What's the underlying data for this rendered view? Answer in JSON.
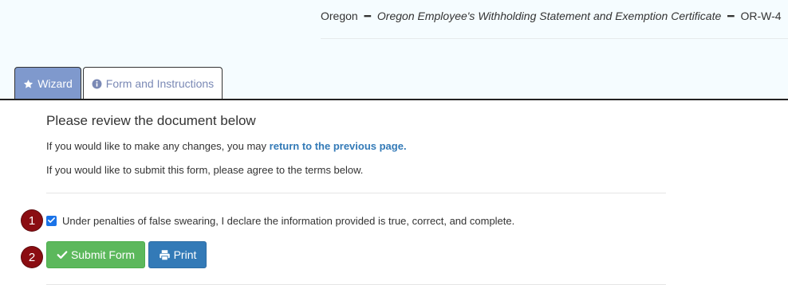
{
  "header": {
    "state": "Oregon",
    "separator": "━",
    "document_name": "Oregon Employee's Withholding Statement and Exemption Certificate",
    "form_code": "OR-W-4"
  },
  "tabs": [
    {
      "label": "Wizard",
      "icon": "star-icon",
      "active": true
    },
    {
      "label": "Form and Instructions",
      "icon": "info-circle-icon",
      "active": false
    }
  ],
  "review": {
    "heading": "Please review the document below",
    "changes_prefix": "If you would like to make any changes, you may ",
    "changes_link": "return to the previous page.",
    "submit_text": "If you would like to submit this form, please agree to the terms below."
  },
  "agreement": {
    "checked": true,
    "label": "Under penalties of false swearing, I declare the information provided is true, correct, and complete."
  },
  "buttons": {
    "submit": "Submit Form",
    "print": "Print"
  },
  "annotations": [
    "1",
    "2"
  ],
  "colors": {
    "tab_active": "#7f99cd",
    "link": "#337ab7",
    "submit": "#5cb85c",
    "print": "#337ab7",
    "badge": "#8b0d12"
  }
}
